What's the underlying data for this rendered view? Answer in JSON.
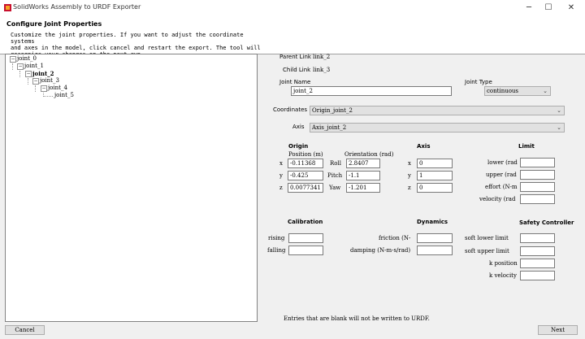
{
  "window": {
    "title": "SolidWorks Assembly to URDF Exporter"
  },
  "header": {
    "title": "Configure Joint Properties",
    "description": "Customize the joint properties. If you want to adjust the coordinate systems\nand axes in the model, click cancel and restart the export. The tool will\nrecognize your changes on the next run."
  },
  "tree": {
    "nodes": [
      "joint_0",
      "joint_1",
      "joint_2",
      "joint_3",
      "joint_4",
      "joint_5"
    ]
  },
  "links": {
    "parent_label": "Parent Link",
    "parent_value": "link_2",
    "child_label": "Child Link",
    "child_value": "link_3"
  },
  "joint": {
    "name_label": "Joint Name",
    "name_value": "joint_2",
    "type_label": "Joint Type",
    "type_value": "continuous"
  },
  "coords": {
    "coordinates_label": "Coordinates",
    "coordinates_value": "Origin_joint_2",
    "axis_label": "Axis",
    "axis_value": "Axis_joint_2"
  },
  "origin": {
    "title": "Origin",
    "position_label": "Position (m)",
    "orientation_label": "Orientation (rad)",
    "x_label": "x",
    "y_label": "y",
    "z_label": "z",
    "x": "-0.11368",
    "y": "-0.425",
    "z": "0.0077341",
    "roll_label": "Roll",
    "pitch_label": "Pitch",
    "yaw_label": "Yaw",
    "roll": "2.8407",
    "pitch": "-1.1",
    "yaw": "-1.201"
  },
  "axis": {
    "title": "Axis",
    "x_label": "x",
    "y_label": "y",
    "z_label": "z",
    "x": "0",
    "y": "1",
    "z": "0"
  },
  "limit": {
    "title": "Limit",
    "lower_label": "lower (rad",
    "upper_label": "upper (rad",
    "effort_label": "effort (N-m",
    "velocity_label": "velocity (rad",
    "lower": "",
    "upper": "",
    "effort": "",
    "velocity": ""
  },
  "calibration": {
    "title": "Calibration",
    "rising_label": "rising",
    "falling_label": "falling",
    "rising": "",
    "falling": ""
  },
  "dynamics": {
    "title": "Dynamics",
    "friction_label": "friction (N-",
    "damping_label": "damping (N-m-s/rad)",
    "friction": "",
    "damping": ""
  },
  "safety": {
    "title": "Safety Controller",
    "soft_lower_label": "soft lower limit",
    "soft_upper_label": "soft upper limit",
    "k_position_label": "k position",
    "k_velocity_label": "k velocity",
    "soft_lower": "",
    "soft_upper": "",
    "k_position": "",
    "k_velocity": ""
  },
  "footer": {
    "note": "Entries that are blank will not be written to URDF.",
    "cancel": "Cancel",
    "next": "Next"
  }
}
